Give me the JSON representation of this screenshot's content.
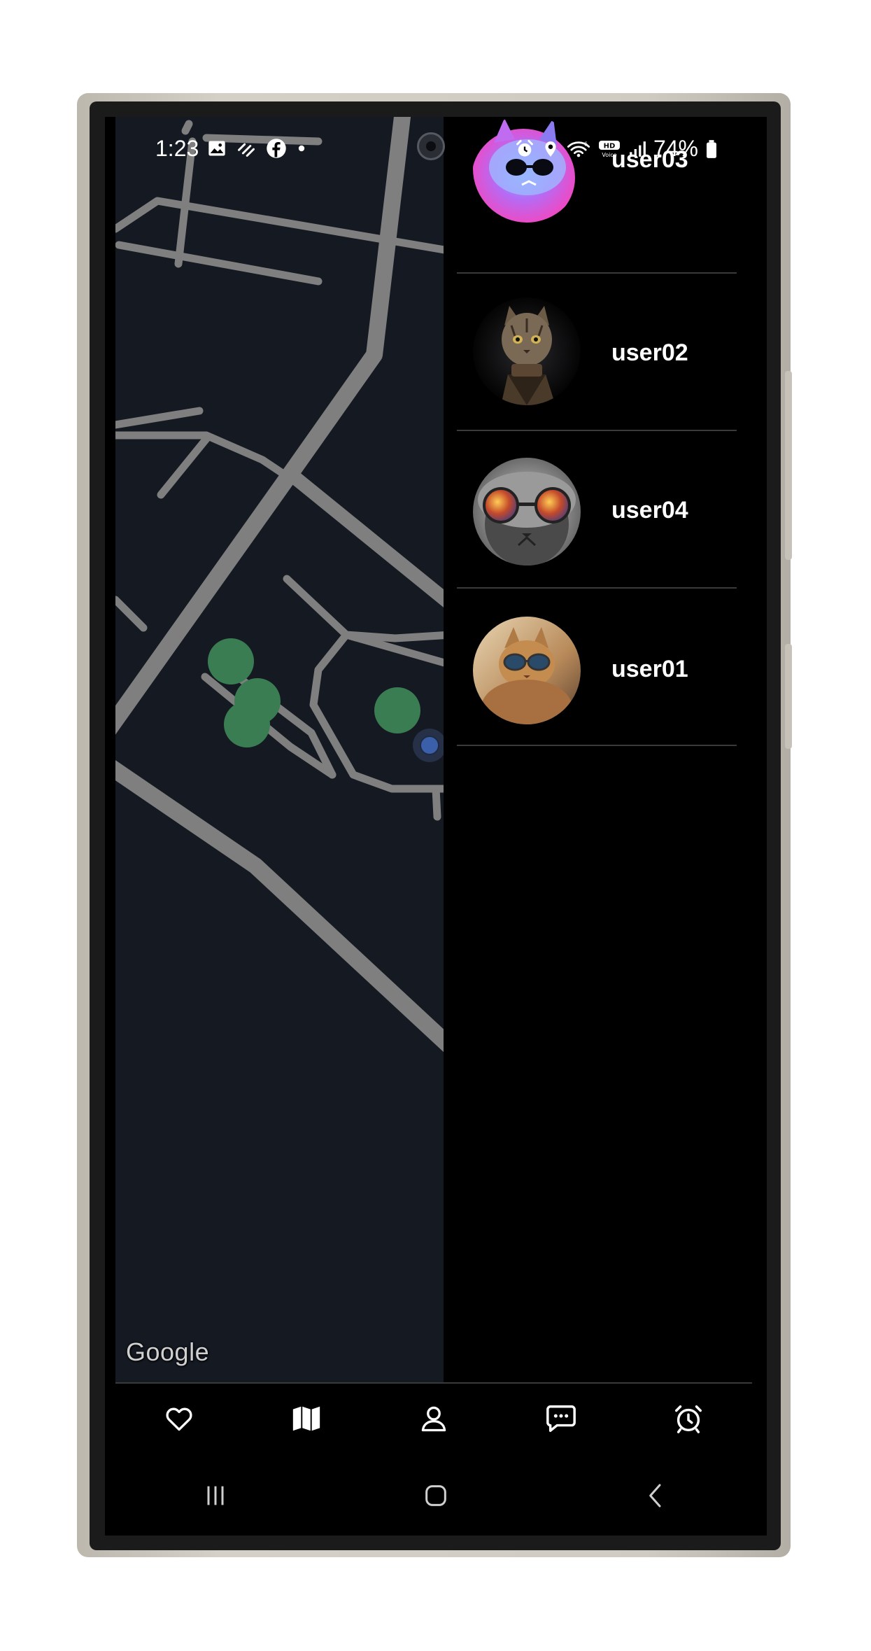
{
  "status_bar": {
    "time": "1:23",
    "battery": "74%",
    "left_icons": [
      "gallery-icon",
      "sync-icon",
      "facebook-icon",
      "dot-icon"
    ],
    "right_icons": [
      "alarm-icon",
      "location-icon",
      "wifi-icon",
      "hd-voice-icon",
      "signal-icon",
      "battery-icon"
    ]
  },
  "map": {
    "attribution": "Google",
    "marker_color": "#3a7d52",
    "location_dot_color": "#3b5fa8",
    "road_color": "#7f7f7f",
    "background": "#141922"
  },
  "users": [
    {
      "name": "user03",
      "avatar": "neon-cat-sunglasses"
    },
    {
      "name": "user02",
      "avatar": "cat-in-jacket"
    },
    {
      "name": "user04",
      "avatar": "cat-reflective-goggles"
    },
    {
      "name": "user01",
      "avatar": "cat-sunglasses-beach"
    }
  ],
  "bottom_nav": {
    "items": [
      "heart-icon",
      "map-icon",
      "profile-icon",
      "chat-icon",
      "alarm-clock-icon"
    ],
    "active": "map-icon"
  },
  "system_nav": [
    "recents-button",
    "home-button",
    "back-button"
  ]
}
